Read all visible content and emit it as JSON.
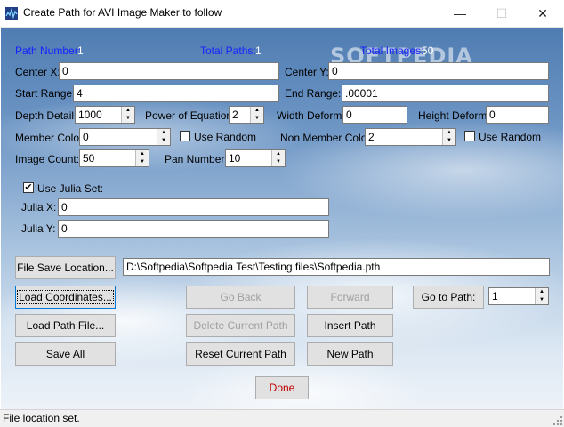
{
  "window": {
    "title": "Create Path for AVI Image Maker to follow",
    "minimize": "—",
    "maximize": "☐",
    "close": "✕"
  },
  "watermark": "SOFTPEDIA",
  "summary": {
    "path_number_label": "Path Number:",
    "path_number_value": "1",
    "total_paths_label": "Total Paths:",
    "total_paths_value": "1",
    "total_images_label": "Total Images:",
    "total_images_value": "50"
  },
  "fields": {
    "center_x_label": "Center X:",
    "center_x_value": "0",
    "center_y_label": "Center Y:",
    "center_y_value": "0",
    "start_range_label": "Start Range:",
    "start_range_value": "4",
    "end_range_label": "End Range:",
    "end_range_value": ".00001",
    "depth_detail_label": "Depth Detail:",
    "depth_detail_value": "1000",
    "power_label": "Power of Equation:",
    "power_value": "2",
    "width_deform_label": "Width Deform:",
    "width_deform_value": "0",
    "height_deform_label": "Height Deform:",
    "height_deform_value": "0",
    "member_color_label": "Member Color:",
    "member_color_value": "0",
    "use_random_label": "Use Random",
    "non_member_color_label": "Non Member Color:",
    "non_member_color_value": "2",
    "use_random2_label": "Use Random",
    "image_count_label": "Image Count:",
    "image_count_value": "50",
    "pan_number_label": "Pan Number:",
    "pan_number_value": "10",
    "use_julia_label": "Use Julia Set:",
    "use_julia_checked": "✔",
    "julia_x_label": "Julia X:",
    "julia_x_value": "0",
    "julia_y_label": "Julia Y:",
    "julia_y_value": "0"
  },
  "file": {
    "save_location_button": "File Save Location...",
    "path_value": "D:\\Softpedia\\Softpedia Test\\Testing files\\Softpedia.pth"
  },
  "buttons": {
    "load_coordinates": "Load Coordinates...",
    "load_path_file": "Load Path File...",
    "save_all": "Save All",
    "go_back": "Go Back",
    "forward": "Forward",
    "delete_current_path": "Delete Current Path",
    "insert_path": "Insert Path",
    "reset_current_path": "Reset Current Path",
    "new_path": "New Path",
    "go_to_path": "Go to Path:",
    "go_to_path_value": "1",
    "done": "Done"
  },
  "status": {
    "text": "File location set."
  },
  "colors": {
    "label_blue": "#1a20ff",
    "done_red": "#c00000",
    "sky_top": "#4f7cb2",
    "sky_bottom": "#edf2f8"
  }
}
